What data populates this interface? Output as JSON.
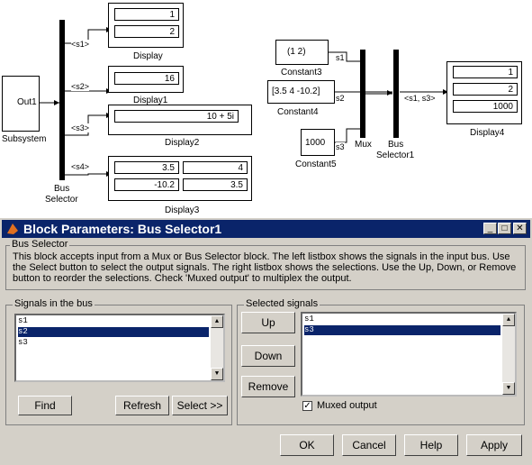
{
  "diagram": {
    "subsystem": {
      "port_label": "Out1",
      "name": "Subsystem"
    },
    "bus_selector_left": {
      "name_line1": "Bus",
      "name_line2": "Selector"
    },
    "signals_left": [
      "<s1>",
      "<s2>",
      "<s3>",
      "<s4>"
    ],
    "display": {
      "name": "Display",
      "values": [
        "1",
        "2"
      ]
    },
    "display1": {
      "name": "Display1",
      "value": "16"
    },
    "display2": {
      "name": "Display2",
      "value": "10 + 5i"
    },
    "display3": {
      "name": "Display3",
      "values": [
        "3.5",
        "4",
        "-10.2",
        "3.5"
      ]
    },
    "constant3": {
      "name": "Constant3",
      "value": "(1   2)"
    },
    "constant4": {
      "name": "Constant4",
      "value": "[3.5 4 -10.2]"
    },
    "constant5": {
      "name": "Constant5",
      "value": "1000"
    },
    "mux": {
      "name": "Mux",
      "inputs": [
        "s1",
        "s2",
        "s3"
      ]
    },
    "bus_selector1": {
      "name_line1": "Bus",
      "name_line2": "Selector1",
      "output_label": "<s1, s3>"
    },
    "display4": {
      "name": "Display4",
      "values": [
        "1",
        "2",
        "1000"
      ]
    }
  },
  "dialog": {
    "title": "Block Parameters: Bus Selector1",
    "group_label": "Bus Selector",
    "description": "This block accepts input from a Mux or Bus Selector block. The left listbox shows the signals in the input bus. Use the Select button to select the output signals. The right listbox shows the selections. Use the Up, Down, or Remove button to reorder the selections. Check 'Muxed output' to multiplex the output.",
    "signals_label": "Signals in the bus",
    "signals": [
      "s1",
      "s2",
      "s3"
    ],
    "selected_label": "Selected signals",
    "selected": [
      "s1",
      "s3"
    ],
    "buttons": {
      "find": "Find",
      "refresh": "Refresh",
      "select": "Select >>",
      "up": "Up",
      "down": "Down",
      "remove": "Remove",
      "ok": "OK",
      "cancel": "Cancel",
      "help": "Help",
      "apply": "Apply"
    },
    "muxed_label": "Muxed output",
    "muxed_checked": true
  }
}
